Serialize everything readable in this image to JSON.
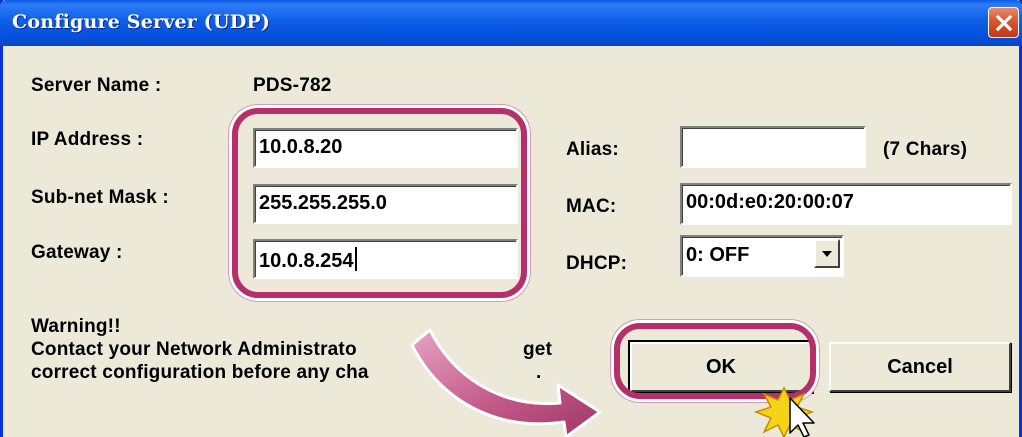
{
  "window": {
    "title": "Configure Server (UDP)"
  },
  "form": {
    "server_name_label": "Server Name :",
    "server_name_value": "PDS-782",
    "ip_label": "IP Address :",
    "ip_value": "10.0.8.20",
    "mask_label": "Sub-net Mask :",
    "mask_value": "255.255.255.0",
    "gateway_label": "Gateway :",
    "gateway_value": "10.0.8.254",
    "alias_label": "Alias:",
    "alias_value": "",
    "alias_hint": "(7 Chars)",
    "mac_label": "MAC:",
    "mac_value": "00:0d:e0:20:00:07",
    "dhcp_label": "DHCP:",
    "dhcp_value": "0: OFF"
  },
  "warning": {
    "line1": "Warning!!",
    "line2": "Contact your Network Administrato",
    "line2_tail": "get",
    "line3": "correct  configuration before any cha",
    "line3_tail": "."
  },
  "buttons": {
    "ok_label": "OK",
    "cancel_label": "Cancel"
  },
  "icons": {
    "close": "close-icon",
    "dropdown": "chevron-down-icon",
    "arrow": "curved-arrow-icon",
    "cursor": "mouse-pointer-icon",
    "click_burst": "click-burst-icon"
  },
  "colors": {
    "titlebar": "#0a5ae6",
    "dialog_bg": "#ece9d8",
    "highlight": "#b5306b",
    "close_button": "#d9562f",
    "click_burst": "#f5d316"
  }
}
